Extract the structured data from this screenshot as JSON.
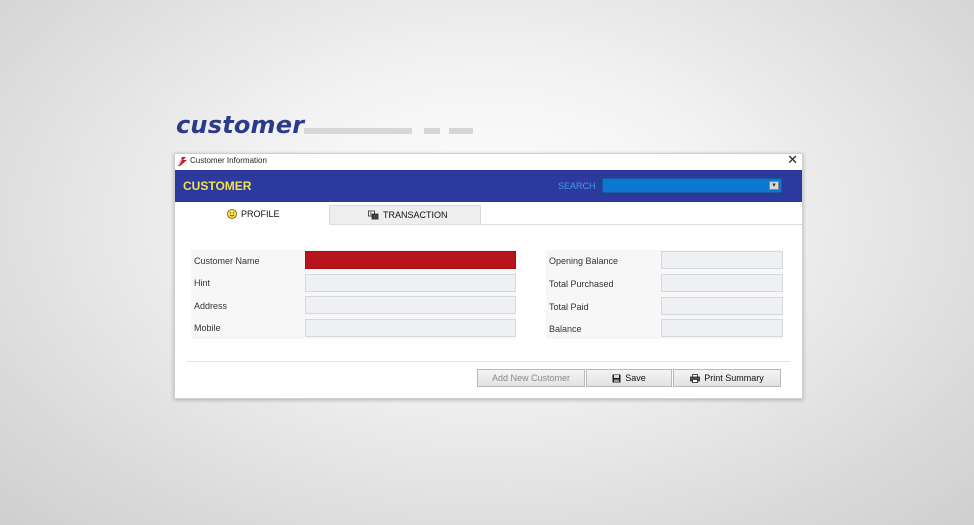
{
  "hero": {
    "title": "customer"
  },
  "window": {
    "title": "Customer Information",
    "close_glyph": "✕",
    "header_title": "CUSTOMER",
    "search": {
      "label": "SEARCH",
      "value": "",
      "arrow": "▾"
    }
  },
  "tabs": [
    {
      "label": "PROFILE",
      "icon": "smiley-icon",
      "active": true
    },
    {
      "label": "TRANSACTION",
      "icon": "money-transfer-icon",
      "active": false
    }
  ],
  "profile": {
    "left_fields": [
      {
        "label": "Customer Name",
        "value": "",
        "color": "#b8141b"
      },
      {
        "label": "Hint",
        "value": ""
      },
      {
        "label": "Address",
        "value": ""
      },
      {
        "label": "Mobile",
        "value": ""
      }
    ],
    "right_fields": [
      {
        "label": "Opening Balance",
        "value": ""
      },
      {
        "label": "Total Purchased",
        "value": ""
      },
      {
        "label": "Total Paid",
        "value": ""
      },
      {
        "label": "Balance",
        "value": ""
      }
    ]
  },
  "buttons": {
    "add_new": "Add New Customer",
    "save": "Save",
    "print": "Print Summary"
  },
  "colors": {
    "header_band": "#2b3a9c",
    "header_title": "#f4e24d",
    "search_box": "#0a78d0",
    "hero_title": "#2c3a8c"
  }
}
